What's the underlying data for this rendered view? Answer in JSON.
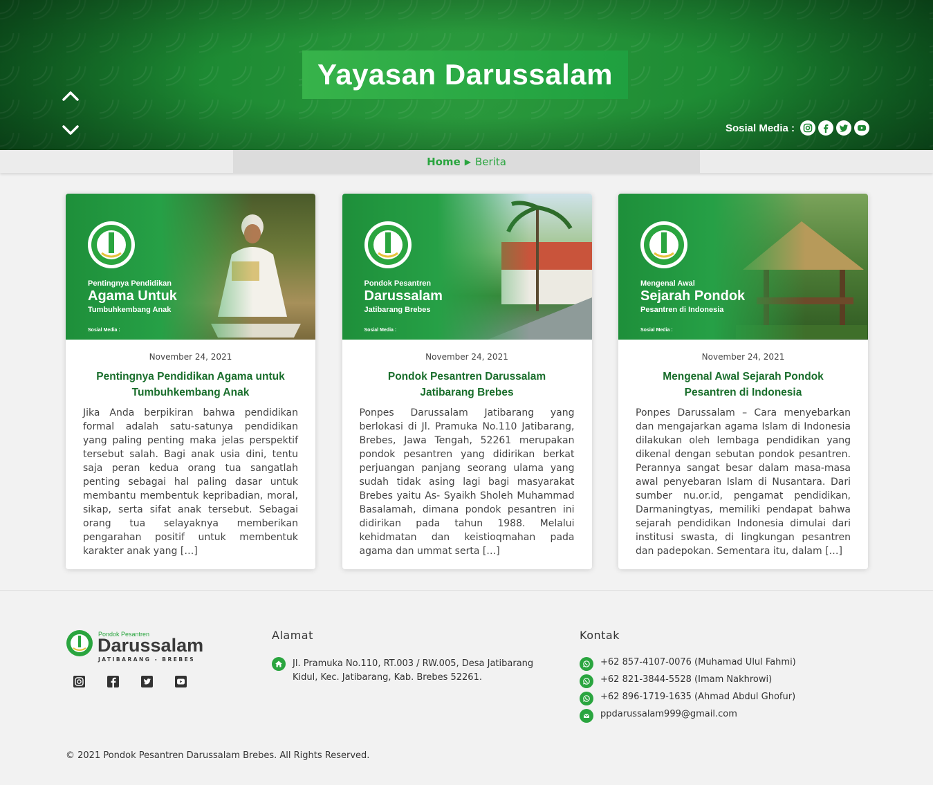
{
  "hero": {
    "title": "Yayasan Darussalam",
    "social_label": "Sosial Media :",
    "social_icons": [
      "instagram-icon",
      "facebook-icon",
      "twitter-icon",
      "youtube-icon"
    ]
  },
  "breadcrumb": {
    "home": "Home",
    "separator": "▶",
    "current": "Berita"
  },
  "posts": [
    {
      "thumb": {
        "line1": "Pentingnya Pendidikan",
        "line2": "Agama Untuk",
        "line3": "Tumbuhkembang Anak",
        "social": "Sosial Media :"
      },
      "date": "November 24, 2021",
      "title": "Pentingnya Pendidikan Agama untuk Tumbuhkembang Anak",
      "excerpt": "Jika Anda berpikiran bahwa pendidikan formal adalah satu-satunya pendidikan yang paling penting maka jelas perspektif tersebut salah. Bagi anak usia dini, tentu saja peran kedua orang tua sangatlah penting sebagai hal paling dasar untuk membantu membentuk kepribadian, moral, sikap, serta sifat anak tersebut. Sebagai orang tua selayaknya memberikan pengarahan positif untuk membentuk karakter anak yang […]"
    },
    {
      "thumb": {
        "line1": "Pondok Pesantren",
        "line2": "Darussalam",
        "line3": "Jatibarang Brebes",
        "social": "Sosial Media :"
      },
      "date": "November 24, 2021",
      "title": "Pondok Pesantren Darussalam Jatibarang Brebes",
      "excerpt": "Ponpes Darussalam Jatibarang yang berlokasi di Jl. Pramuka No.110 Jatibarang, Brebes, Jawa Tengah, 52261 merupakan pondok pesantren yang didirikan berkat perjuangan panjang seorang ulama yang sudah tidak asing lagi bagi masyarakat Brebes yaitu As- Syaikh Sholeh Muhammad Basalamah, dimana pondok pesantren ini didirikan pada tahun 1988. Melalui kehidmatan dan keistioqmahan pada agama dan ummat serta […]"
    },
    {
      "thumb": {
        "line1": "Mengenal Awal",
        "line2": "Sejarah Pondok",
        "line3": "Pesantren di Indonesia",
        "social": "Sosial Media :"
      },
      "date": "November 24, 2021",
      "title": "Mengenal Awal Sejarah Pondok Pesantren di Indonesia",
      "excerpt": "Ponpes Darussalam – Cara menyebarkan dan mengajarkan agama Islam di Indonesia dilakukan oleh lembaga pendidikan yang dikenal dengan sebutan pondok pesantren. Perannya sangat besar dalam masa-masa awal penyebaran Islam di Nusantara. Dari sumber nu.or.id, pengamat pendidikan, Darmaningtyas, memiliki pendapat bahwa sejarah pendidikan Indonesia dimulai dari institusi swasta, di lingkungan pesantren dan padepokan. Sementara itu, dalam […]"
    }
  ],
  "footer": {
    "logo_small": "Pondok Pesantren",
    "logo_big": "Darussalam",
    "logo_sub": "JATIBARANG - BREBES",
    "address_heading": "Alamat",
    "address": "Jl. Pramuka No.110, RT.003 / RW.005, Desa Jatibarang Kidul, Kec. Jatibarang, Kab. Brebes 52261.",
    "contact_heading": "Kontak",
    "contacts": [
      "+62 857-4107-0076 (Muhamad Ulul Fahmi)",
      "+62 821-3844-5528 (Imam Nakhrowi)",
      "+62 896-1719-1635 (Ahmad Abdul Ghofur)",
      "ppdarussalam999@gmail.com"
    ],
    "copyright": "© 2021 Pondok Pesantren Darussalam Brebes. All Rights Reserved."
  },
  "colors": {
    "brand_green": "#2aa53f",
    "dark_green": "#1a6e2c"
  }
}
